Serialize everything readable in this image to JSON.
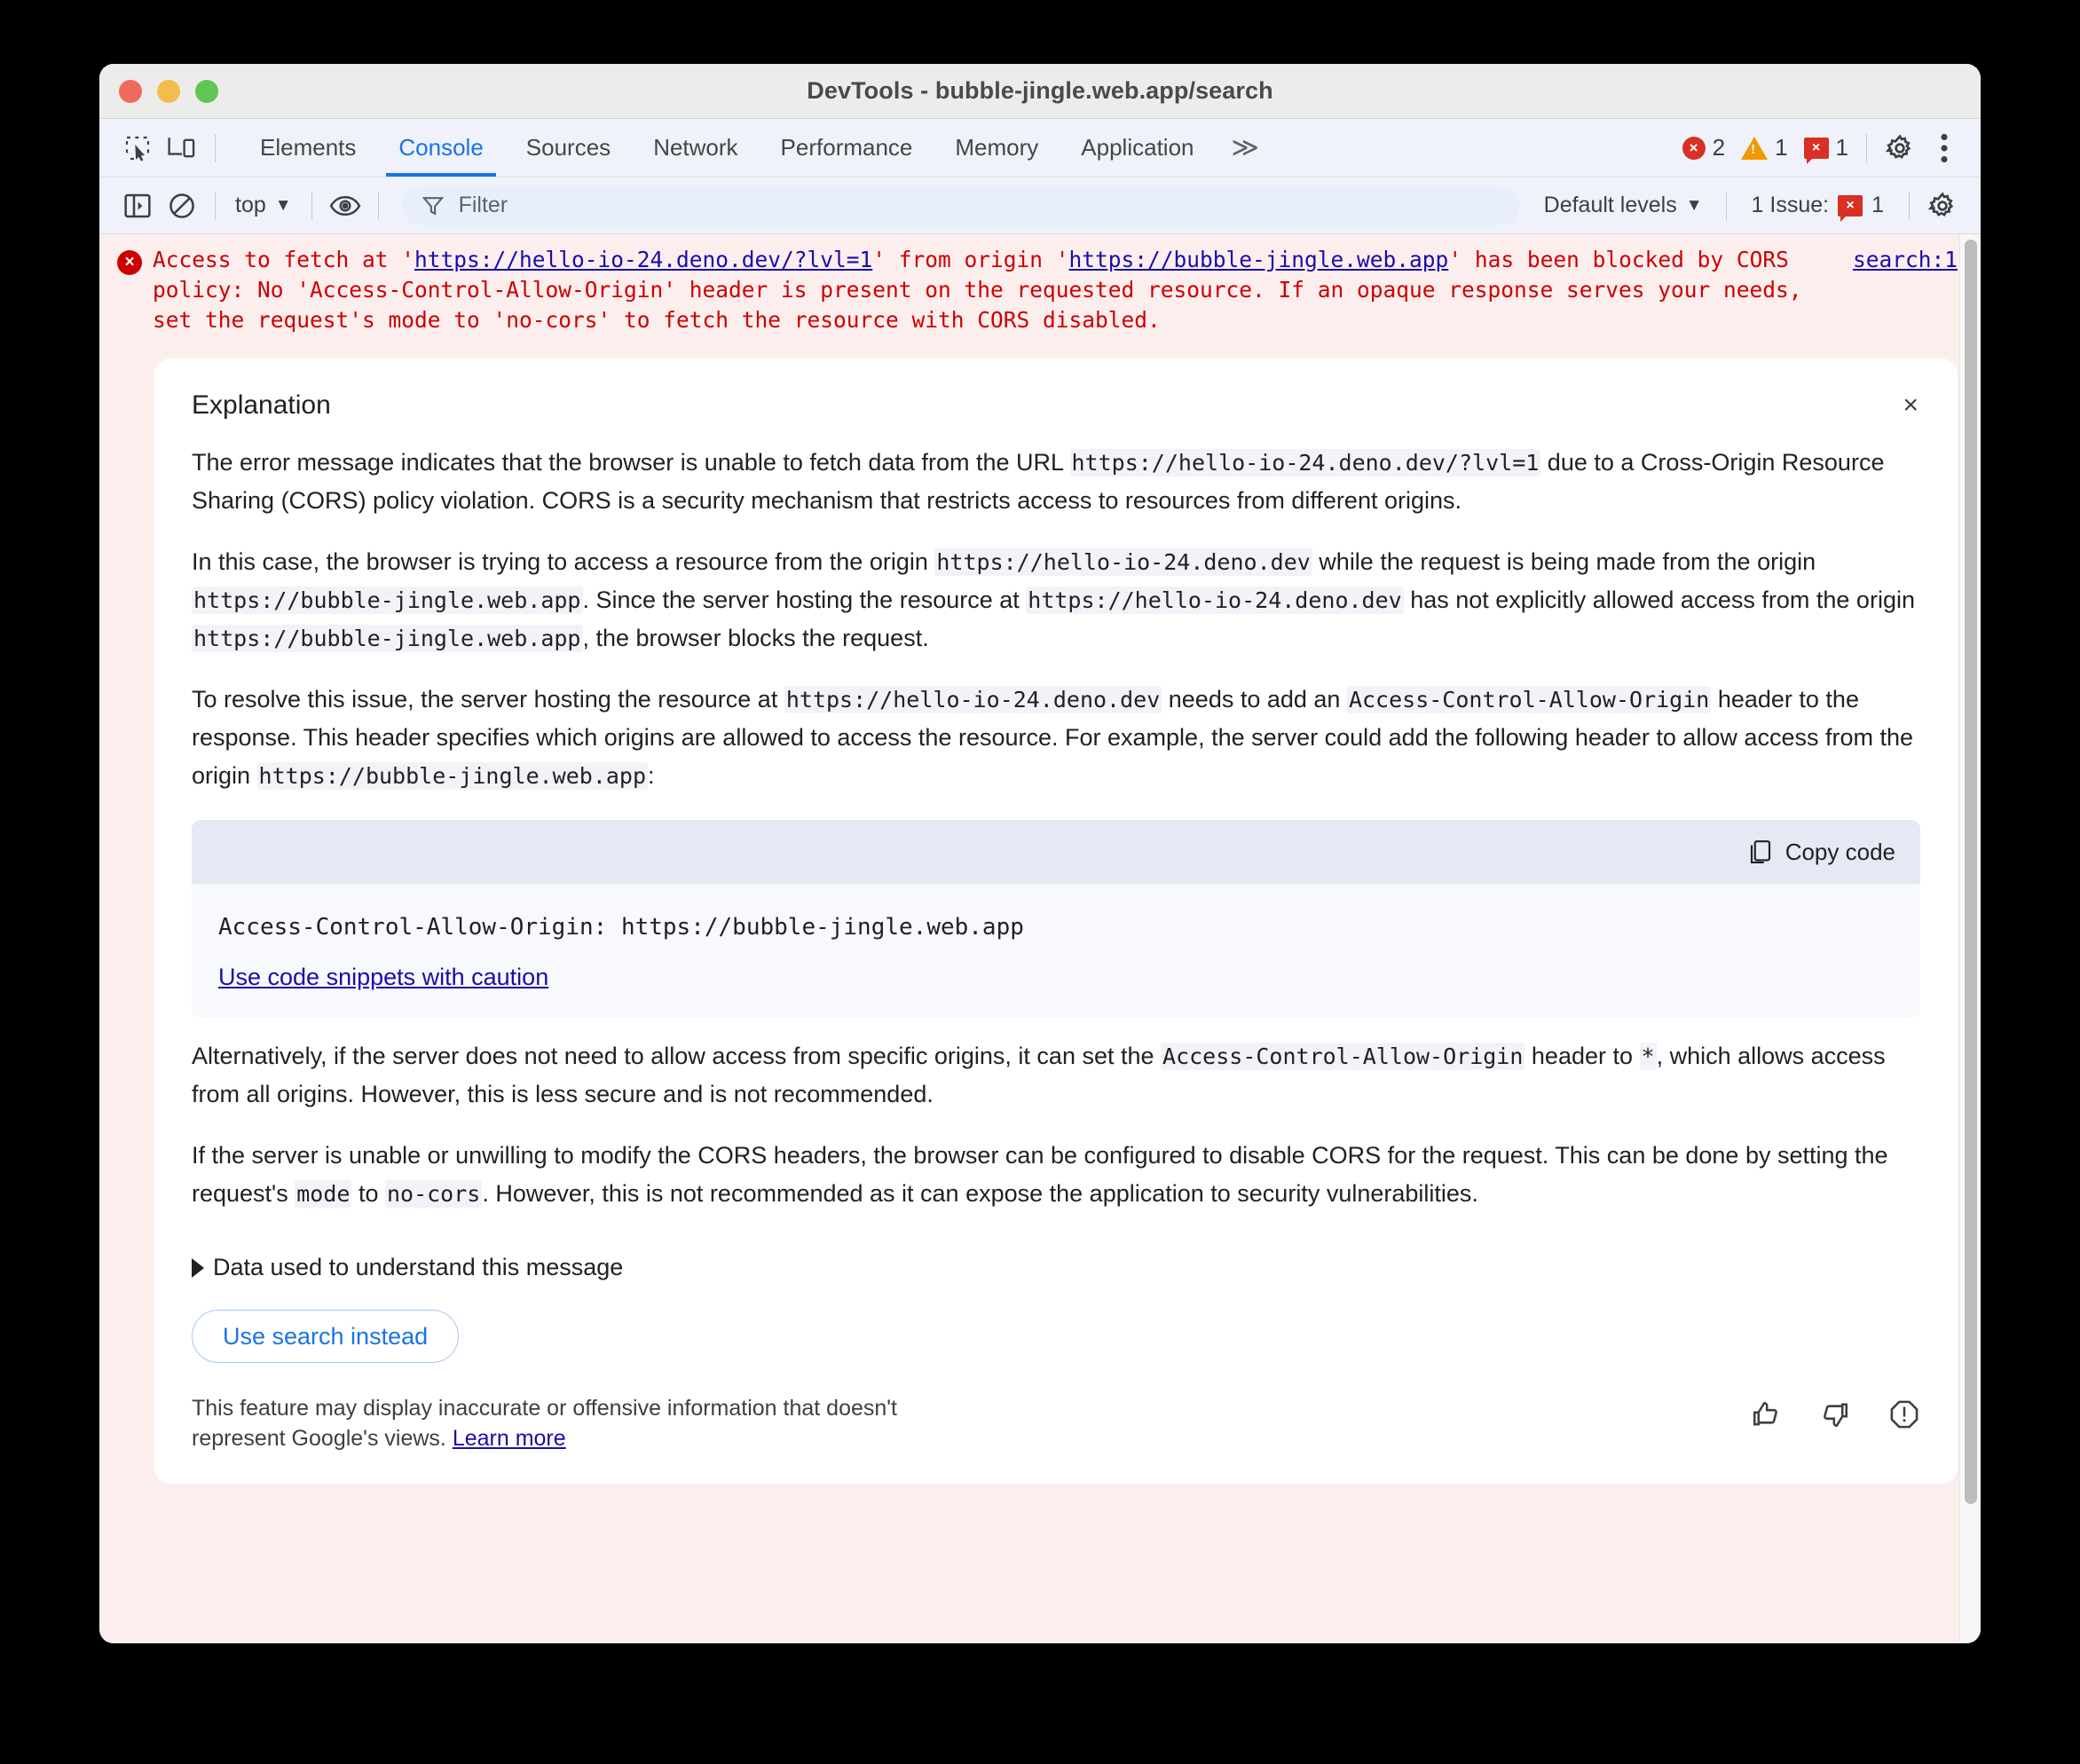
{
  "window": {
    "title": "DevTools - bubble-jingle.web.app/search",
    "traffic_lights": [
      "close",
      "minimize",
      "zoom"
    ]
  },
  "tabbar": {
    "inspect_icon": "inspect-element-icon",
    "device_icon": "device-toolbar-icon",
    "tabs": [
      {
        "label": "Elements",
        "active": false
      },
      {
        "label": "Console",
        "active": true
      },
      {
        "label": "Sources",
        "active": false
      },
      {
        "label": "Network",
        "active": false
      },
      {
        "label": "Performance",
        "active": false
      },
      {
        "label": "Memory",
        "active": false
      },
      {
        "label": "Application",
        "active": false
      }
    ],
    "more_tabs": "≫",
    "error_count": "2",
    "error_glyph": "×",
    "warning_count": "1",
    "warning_glyph": "!",
    "issue_count": "1",
    "issue_glyph": "×",
    "settings_icon": "gear-icon",
    "more_icon": "kebab-menu-icon"
  },
  "console_toolbar": {
    "sidebar_icon": "console-sidebar-icon",
    "clear_icon": "clear-console-icon",
    "context": "top",
    "context_caret": "▼",
    "eye_icon": "live-expression-icon",
    "filter_icon": "filter-icon",
    "filter_value": "",
    "filter_placeholder": "Filter",
    "levels_label": "Default levels",
    "levels_caret": "▼",
    "issues_label": "1 Issue:",
    "issues_count": "1",
    "issues_glyph": "×",
    "settings_icon": "console-settings-gear-icon"
  },
  "console_message": {
    "icon": "error-icon",
    "text_before_url1": "Access to fetch at '",
    "url1": "https://hello-io-24.deno.dev/?lvl=1",
    "text_between": "' from origin '",
    "url2": "https://bubble-jingle.web.app",
    "text_after": "' has been blocked by CORS policy: No 'Access-Control-Allow-Origin' header is present on the requested resource. If an opaque response serves your needs, set the request's mode to 'no-cors' to fetch the resource with CORS disabled.",
    "source_link": "search:1"
  },
  "explanation": {
    "title": "Explanation",
    "close_glyph": "×",
    "paragraphs": [
      {
        "parts": [
          {
            "type": "text",
            "value": "The error message indicates that the browser is unable to fetch data from the URL "
          },
          {
            "type": "code",
            "value": "https://hello-io-24.deno.dev/?lvl=1"
          },
          {
            "type": "text",
            "value": " due to a Cross-Origin Resource Sharing (CORS) policy violation. CORS is a security mechanism that restricts access to resources from different origins."
          }
        ]
      },
      {
        "parts": [
          {
            "type": "text",
            "value": "In this case, the browser is trying to access a resource from the origin "
          },
          {
            "type": "code",
            "value": "https://hello-io-24.deno.dev"
          },
          {
            "type": "text",
            "value": " while the request is being made from the origin "
          },
          {
            "type": "code",
            "value": "https://bubble-jingle.web.app"
          },
          {
            "type": "text",
            "value": ". Since the server hosting the resource at "
          },
          {
            "type": "code",
            "value": "https://hello-io-24.deno.dev"
          },
          {
            "type": "text",
            "value": " has not explicitly allowed access from the origin "
          },
          {
            "type": "code",
            "value": "https://bubble-jingle.web.app"
          },
          {
            "type": "text",
            "value": ", the browser blocks the request."
          }
        ]
      },
      {
        "parts": [
          {
            "type": "text",
            "value": "To resolve this issue, the server hosting the resource at "
          },
          {
            "type": "code",
            "value": "https://hello-io-24.deno.dev"
          },
          {
            "type": "text",
            "value": " needs to add an "
          },
          {
            "type": "code",
            "value": "Access-Control-Allow-Origin"
          },
          {
            "type": "text",
            "value": " header to the response. This header specifies which origins are allowed to access the resource. For example, the server could add the following header to allow access from the origin "
          },
          {
            "type": "code",
            "value": "https://bubble-jingle.web.app"
          },
          {
            "type": "text",
            "value": ":"
          }
        ]
      }
    ],
    "code_block": {
      "copy_label": "Copy code",
      "copy_icon": "copy-icon",
      "code": "Access-Control-Allow-Origin: https://bubble-jingle.web.app",
      "caution_link": "Use code snippets with caution"
    },
    "paragraphs_after": [
      {
        "parts": [
          {
            "type": "text",
            "value": "Alternatively, if the server does not need to allow access from specific origins, it can set the "
          },
          {
            "type": "code",
            "value": "Access-Control-Allow-Origin"
          },
          {
            "type": "text",
            "value": " header to "
          },
          {
            "type": "code",
            "value": "*"
          },
          {
            "type": "text",
            "value": ", which allows access from all origins. However, this is less secure and is not recommended."
          }
        ]
      },
      {
        "parts": [
          {
            "type": "text",
            "value": "If the server is unable or unwilling to modify the CORS headers, the browser can be configured to disable CORS for the request. This can be done by setting the request's "
          },
          {
            "type": "code",
            "value": "mode"
          },
          {
            "type": "text",
            "value": " to "
          },
          {
            "type": "code",
            "value": "no-cors"
          },
          {
            "type": "text",
            "value": ". However, this is not recommended as it can expose the application to security vulnerabilities."
          }
        ]
      }
    ],
    "disclosure_label": "Data used to understand this message",
    "use_search_label": "Use search instead",
    "disclaimer_text": "This feature may display inaccurate or offensive information that doesn't represent Google's views. ",
    "disclaimer_link": "Learn more",
    "feedback_icons": [
      "thumb-up-icon",
      "thumb-down-icon",
      "report-icon"
    ]
  }
}
